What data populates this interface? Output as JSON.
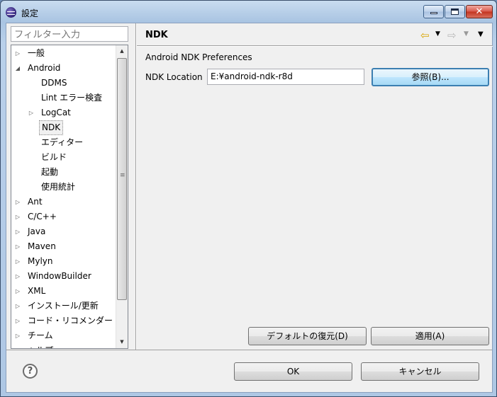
{
  "window": {
    "title": "設定"
  },
  "titlebar_buttons": {
    "minimize": "minimize",
    "maximize": "maximize",
    "close": "✕"
  },
  "filter": {
    "placeholder": "フィルター入力"
  },
  "tree": {
    "items": [
      {
        "label": "一般",
        "level": 0,
        "twisty": "collapsed"
      },
      {
        "label": "Android",
        "level": 0,
        "twisty": "expanded"
      },
      {
        "label": "DDMS",
        "level": 1,
        "twisty": "none"
      },
      {
        "label": "Lint エラー検査",
        "level": 1,
        "twisty": "none"
      },
      {
        "label": "LogCat",
        "level": 1,
        "twisty": "collapsed"
      },
      {
        "label": "NDK",
        "level": 1,
        "twisty": "none",
        "selected": true
      },
      {
        "label": "エディター",
        "level": 1,
        "twisty": "none"
      },
      {
        "label": "ビルド",
        "level": 1,
        "twisty": "none"
      },
      {
        "label": "起動",
        "level": 1,
        "twisty": "none"
      },
      {
        "label": "使用統計",
        "level": 1,
        "twisty": "none"
      },
      {
        "label": "Ant",
        "level": 0,
        "twisty": "collapsed"
      },
      {
        "label": "C/C++",
        "level": 0,
        "twisty": "collapsed"
      },
      {
        "label": "Java",
        "level": 0,
        "twisty": "collapsed"
      },
      {
        "label": "Maven",
        "level": 0,
        "twisty": "collapsed"
      },
      {
        "label": "Mylyn",
        "level": 0,
        "twisty": "collapsed"
      },
      {
        "label": "WindowBuilder",
        "level": 0,
        "twisty": "collapsed"
      },
      {
        "label": "XML",
        "level": 0,
        "twisty": "collapsed"
      },
      {
        "label": "インストール/更新",
        "level": 0,
        "twisty": "collapsed"
      },
      {
        "label": "コード・リコメンダー",
        "level": 0,
        "twisty": "collapsed"
      },
      {
        "label": "チーム",
        "level": 0,
        "twisty": "collapsed"
      },
      {
        "label": "ヘルプ",
        "level": 0,
        "twisty": "collapsed"
      }
    ]
  },
  "page": {
    "title": "NDK",
    "section_label": "Android NDK Preferences",
    "ndk_location_label": "NDK Location",
    "ndk_location_value": "E:¥android-ndk-r8d",
    "browse_label": "参照(B)...",
    "restore_defaults_label": "デフォルトの復元(D)",
    "apply_label": "適用(A)"
  },
  "footer": {
    "ok_label": "OK",
    "cancel_label": "キャンセル",
    "help_glyph": "?"
  },
  "icons": {
    "back": "back-arrow-icon",
    "forward": "forward-arrow-icon",
    "view_menu": "view-menu-icon",
    "help": "help-icon"
  },
  "colors": {
    "titlebar": "#b9d0ea",
    "close_button": "#c2331f",
    "focus_border": "#3c7fb1",
    "back_arrow": "#d9a400"
  }
}
